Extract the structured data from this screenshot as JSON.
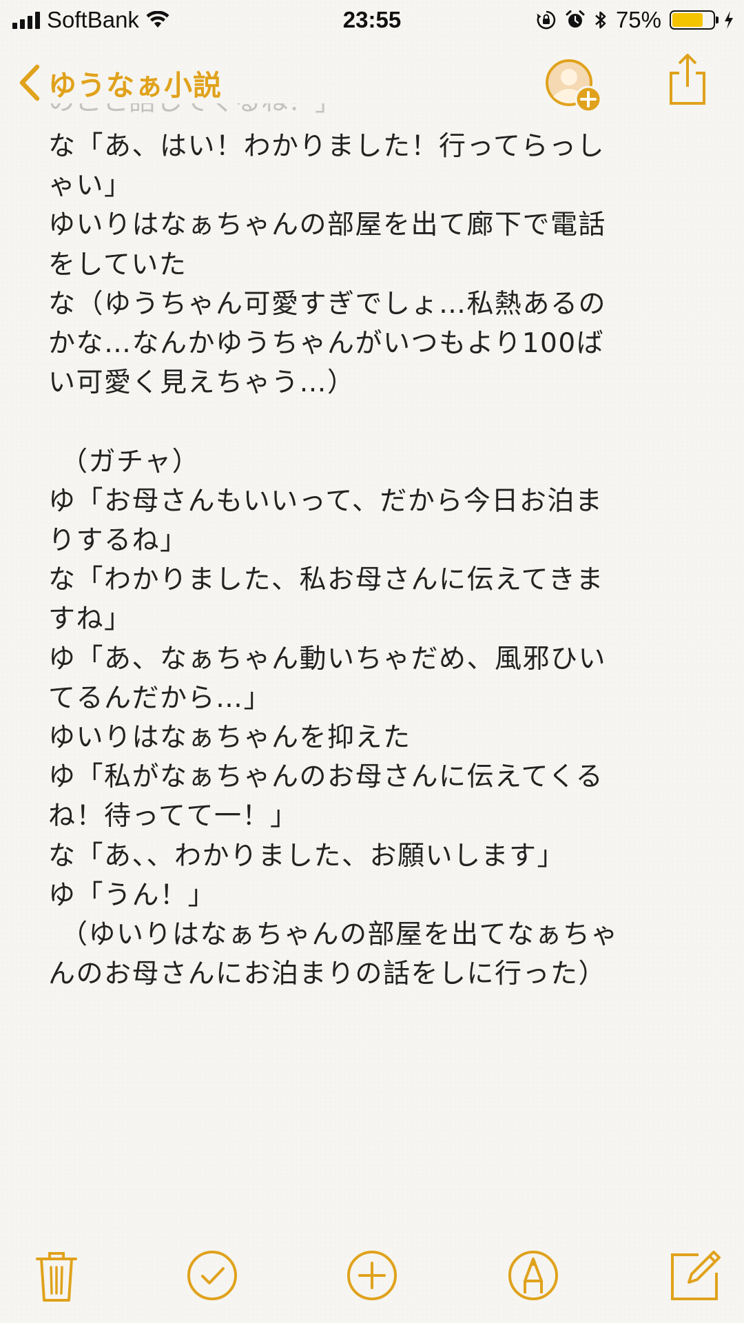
{
  "status_bar": {
    "carrier": "SoftBank",
    "time": "23:55",
    "battery_percent_label": "75%",
    "battery_level": 0.75,
    "battery_color": "#f5c400"
  },
  "nav": {
    "back_label": "ゆうなぁ小説",
    "accent_color": "#e0a21c"
  },
  "note": {
    "partial_top_line": "のこと話してくるね？」",
    "lines": [
      "な「あ、はい！わかりました！行ってらっし",
      "ゃい」",
      "ゆいりはなぁちゃんの部屋を出て廊下で電話",
      "をしていた",
      "な（ゆうちゃん可愛すぎでしょ…私熱あるの",
      "かな…なんかゆうちゃんがいつもより100ば",
      "い可愛く見えちゃう…）",
      "",
      "（ガチャ）",
      "ゆ「お母さんもいいって、だから今日お泊ま",
      "りするね」",
      "な「わかりました、私お母さんに伝えてきま",
      "すね」",
      "ゆ「あ、なぁちゃん動いちゃだめ、風邪ひい",
      "てるんだから…」",
      "ゆいりはなぁちゃんを抑えた",
      "ゆ「私がなぁちゃんのお母さんに伝えてくる",
      "ね！待ってて一！」",
      "な「あ、、わかりました、お願いします」",
      "ゆ「うん！」",
      "（ゆいりはなぁちゃんの部屋を出てなぁちゃ",
      "んのお母さんにお泊まりの話をしに行った）"
    ]
  },
  "icons": {
    "back": "chevron-left-icon",
    "add_person": "add-person-icon",
    "share": "share-icon",
    "trash": "trash-icon",
    "checklist": "checklist-icon",
    "add": "add-icon",
    "markup": "markup-pen-icon",
    "compose": "compose-icon"
  }
}
